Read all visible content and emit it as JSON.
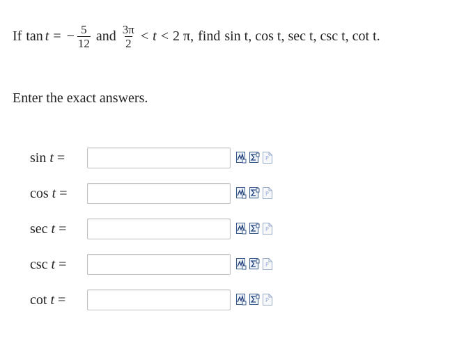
{
  "problem": {
    "prefix": "If",
    "fn": "tan",
    "var": "t",
    "eq": "=",
    "minus": "−",
    "frac1_num": "5",
    "frac1_den": "12",
    "and": "and",
    "frac2_num": "3π",
    "frac2_den": "2",
    "lt1": "<",
    "var2": "t",
    "lt2": "<",
    "upper": "2 π,",
    "find": "find",
    "targets": "sin t, cos t, sec t, csc t, cot t."
  },
  "instructions": "Enter the exact answers.",
  "rows": [
    {
      "fn": "sin",
      "var": "t",
      "eq": "=",
      "value": ""
    },
    {
      "fn": "cos",
      "var": "t",
      "eq": "=",
      "value": ""
    },
    {
      "fn": "sec",
      "var": "t",
      "eq": "=",
      "value": ""
    },
    {
      "fn": "csc",
      "var": "t",
      "eq": "=",
      "value": ""
    },
    {
      "fn": "cot",
      "var": "t",
      "eq": "=",
      "value": ""
    }
  ],
  "tool_icons": [
    "equation-preview-icon",
    "symbol-palette-icon",
    "help-page-icon"
  ]
}
